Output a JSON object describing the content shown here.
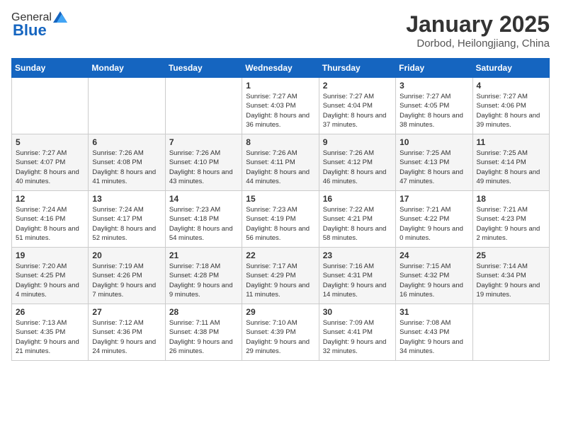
{
  "header": {
    "logo_general": "General",
    "logo_blue": "Blue",
    "month_title": "January 2025",
    "location": "Dorbod, Heilongjiang, China"
  },
  "weekdays": [
    "Sunday",
    "Monday",
    "Tuesday",
    "Wednesday",
    "Thursday",
    "Friday",
    "Saturday"
  ],
  "weeks": [
    [
      {
        "day": "",
        "info": ""
      },
      {
        "day": "",
        "info": ""
      },
      {
        "day": "",
        "info": ""
      },
      {
        "day": "1",
        "info": "Sunrise: 7:27 AM\nSunset: 4:03 PM\nDaylight: 8 hours and 36 minutes."
      },
      {
        "day": "2",
        "info": "Sunrise: 7:27 AM\nSunset: 4:04 PM\nDaylight: 8 hours and 37 minutes."
      },
      {
        "day": "3",
        "info": "Sunrise: 7:27 AM\nSunset: 4:05 PM\nDaylight: 8 hours and 38 minutes."
      },
      {
        "day": "4",
        "info": "Sunrise: 7:27 AM\nSunset: 4:06 PM\nDaylight: 8 hours and 39 minutes."
      }
    ],
    [
      {
        "day": "5",
        "info": "Sunrise: 7:27 AM\nSunset: 4:07 PM\nDaylight: 8 hours and 40 minutes."
      },
      {
        "day": "6",
        "info": "Sunrise: 7:26 AM\nSunset: 4:08 PM\nDaylight: 8 hours and 41 minutes."
      },
      {
        "day": "7",
        "info": "Sunrise: 7:26 AM\nSunset: 4:10 PM\nDaylight: 8 hours and 43 minutes."
      },
      {
        "day": "8",
        "info": "Sunrise: 7:26 AM\nSunset: 4:11 PM\nDaylight: 8 hours and 44 minutes."
      },
      {
        "day": "9",
        "info": "Sunrise: 7:26 AM\nSunset: 4:12 PM\nDaylight: 8 hours and 46 minutes."
      },
      {
        "day": "10",
        "info": "Sunrise: 7:25 AM\nSunset: 4:13 PM\nDaylight: 8 hours and 47 minutes."
      },
      {
        "day": "11",
        "info": "Sunrise: 7:25 AM\nSunset: 4:14 PM\nDaylight: 8 hours and 49 minutes."
      }
    ],
    [
      {
        "day": "12",
        "info": "Sunrise: 7:24 AM\nSunset: 4:16 PM\nDaylight: 8 hours and 51 minutes."
      },
      {
        "day": "13",
        "info": "Sunrise: 7:24 AM\nSunset: 4:17 PM\nDaylight: 8 hours and 52 minutes."
      },
      {
        "day": "14",
        "info": "Sunrise: 7:23 AM\nSunset: 4:18 PM\nDaylight: 8 hours and 54 minutes."
      },
      {
        "day": "15",
        "info": "Sunrise: 7:23 AM\nSunset: 4:19 PM\nDaylight: 8 hours and 56 minutes."
      },
      {
        "day": "16",
        "info": "Sunrise: 7:22 AM\nSunset: 4:21 PM\nDaylight: 8 hours and 58 minutes."
      },
      {
        "day": "17",
        "info": "Sunrise: 7:21 AM\nSunset: 4:22 PM\nDaylight: 9 hours and 0 minutes."
      },
      {
        "day": "18",
        "info": "Sunrise: 7:21 AM\nSunset: 4:23 PM\nDaylight: 9 hours and 2 minutes."
      }
    ],
    [
      {
        "day": "19",
        "info": "Sunrise: 7:20 AM\nSunset: 4:25 PM\nDaylight: 9 hours and 4 minutes."
      },
      {
        "day": "20",
        "info": "Sunrise: 7:19 AM\nSunset: 4:26 PM\nDaylight: 9 hours and 7 minutes."
      },
      {
        "day": "21",
        "info": "Sunrise: 7:18 AM\nSunset: 4:28 PM\nDaylight: 9 hours and 9 minutes."
      },
      {
        "day": "22",
        "info": "Sunrise: 7:17 AM\nSunset: 4:29 PM\nDaylight: 9 hours and 11 minutes."
      },
      {
        "day": "23",
        "info": "Sunrise: 7:16 AM\nSunset: 4:31 PM\nDaylight: 9 hours and 14 minutes."
      },
      {
        "day": "24",
        "info": "Sunrise: 7:15 AM\nSunset: 4:32 PM\nDaylight: 9 hours and 16 minutes."
      },
      {
        "day": "25",
        "info": "Sunrise: 7:14 AM\nSunset: 4:34 PM\nDaylight: 9 hours and 19 minutes."
      }
    ],
    [
      {
        "day": "26",
        "info": "Sunrise: 7:13 AM\nSunset: 4:35 PM\nDaylight: 9 hours and 21 minutes."
      },
      {
        "day": "27",
        "info": "Sunrise: 7:12 AM\nSunset: 4:36 PM\nDaylight: 9 hours and 24 minutes."
      },
      {
        "day": "28",
        "info": "Sunrise: 7:11 AM\nSunset: 4:38 PM\nDaylight: 9 hours and 26 minutes."
      },
      {
        "day": "29",
        "info": "Sunrise: 7:10 AM\nSunset: 4:39 PM\nDaylight: 9 hours and 29 minutes."
      },
      {
        "day": "30",
        "info": "Sunrise: 7:09 AM\nSunset: 4:41 PM\nDaylight: 9 hours and 32 minutes."
      },
      {
        "day": "31",
        "info": "Sunrise: 7:08 AM\nSunset: 4:43 PM\nDaylight: 9 hours and 34 minutes."
      },
      {
        "day": "",
        "info": ""
      }
    ]
  ]
}
